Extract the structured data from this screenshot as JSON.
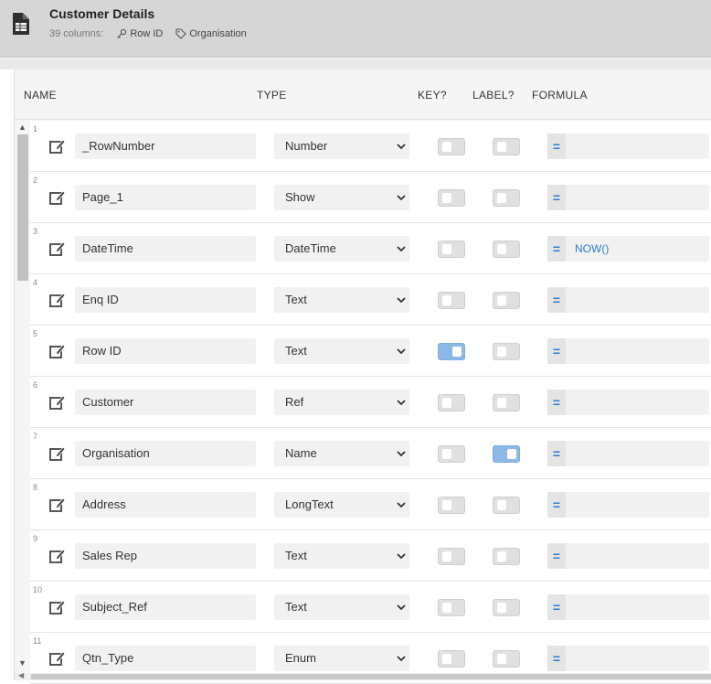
{
  "header": {
    "title": "Customer Details",
    "columns_count": "39 columns:",
    "key_chip": "Row ID",
    "label_chip": "Organisation"
  },
  "columns_header": {
    "name": "NAME",
    "type": "TYPE",
    "key": "KEY?",
    "label": "LABEL?",
    "formula": "FORMULA"
  },
  "colors": {
    "accent": "#2a7cd6",
    "toggle_on": "#8db8e6",
    "header_bg": "#d6d6d6"
  },
  "rows": [
    {
      "num": "1",
      "name": "_RowNumber",
      "type": "Number",
      "key": false,
      "label": false,
      "formula": ""
    },
    {
      "num": "2",
      "name": "Page_1",
      "type": "Show",
      "key": false,
      "label": false,
      "formula": ""
    },
    {
      "num": "3",
      "name": "DateTime",
      "type": "DateTime",
      "key": false,
      "label": false,
      "formula": "NOW()"
    },
    {
      "num": "4",
      "name": "Enq ID",
      "type": "Text",
      "key": false,
      "label": false,
      "formula": ""
    },
    {
      "num": "5",
      "name": "Row ID",
      "type": "Text",
      "key": true,
      "label": false,
      "formula": ""
    },
    {
      "num": "6",
      "name": "Customer",
      "type": "Ref",
      "key": false,
      "label": false,
      "formula": ""
    },
    {
      "num": "7",
      "name": "Organisation",
      "type": "Name",
      "key": false,
      "label": true,
      "formula": ""
    },
    {
      "num": "8",
      "name": "Address",
      "type": "LongText",
      "key": false,
      "label": false,
      "formula": ""
    },
    {
      "num": "9",
      "name": "Sales Rep",
      "type": "Text",
      "key": false,
      "label": false,
      "formula": ""
    },
    {
      "num": "10",
      "name": "Subject_Ref",
      "type": "Text",
      "key": false,
      "label": false,
      "formula": ""
    },
    {
      "num": "11",
      "name": "Qtn_Type",
      "type": "Enum",
      "key": false,
      "label": false,
      "formula": ""
    }
  ]
}
